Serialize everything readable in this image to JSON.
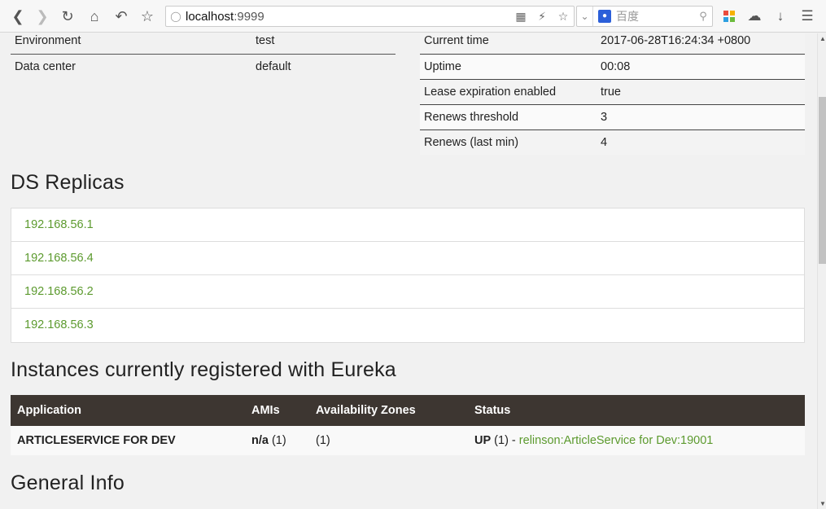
{
  "browser": {
    "url_host": "localhost",
    "url_port": ":9999",
    "search_placeholder": "百度",
    "search_engine_icon": "baidu-paw-icon"
  },
  "env_table": [
    {
      "key": "Environment",
      "value": "test"
    },
    {
      "key": "Data center",
      "value": "default"
    }
  ],
  "status_table": [
    {
      "key": "Current time",
      "value": "2017-06-28T16:24:34 +0800"
    },
    {
      "key": "Uptime",
      "value": "00:08"
    },
    {
      "key": "Lease expiration enabled",
      "value": "true"
    },
    {
      "key": "Renews threshold",
      "value": "3"
    },
    {
      "key": "Renews (last min)",
      "value": "4"
    }
  ],
  "ds_replicas": {
    "title": "DS Replicas",
    "items": [
      "192.168.56.1",
      "192.168.56.4",
      "192.168.56.2",
      "192.168.56.3"
    ]
  },
  "instances": {
    "title": "Instances currently registered with Eureka",
    "headers": [
      "Application",
      "AMIs",
      "Availability Zones",
      "Status"
    ],
    "rows": [
      {
        "application": "ARTICLESERVICE FOR DEV",
        "amis_bold": "n/a",
        "amis_count": " (1)",
        "zones": "(1)",
        "status_bold": "UP",
        "status_count": " (1) - ",
        "status_link": "relinson:ArticleService for Dev:19001"
      }
    ]
  },
  "general_info": {
    "title": "General Info"
  },
  "colors": {
    "link": "#5c9a2e",
    "table_header_bg": "#3d3631"
  }
}
